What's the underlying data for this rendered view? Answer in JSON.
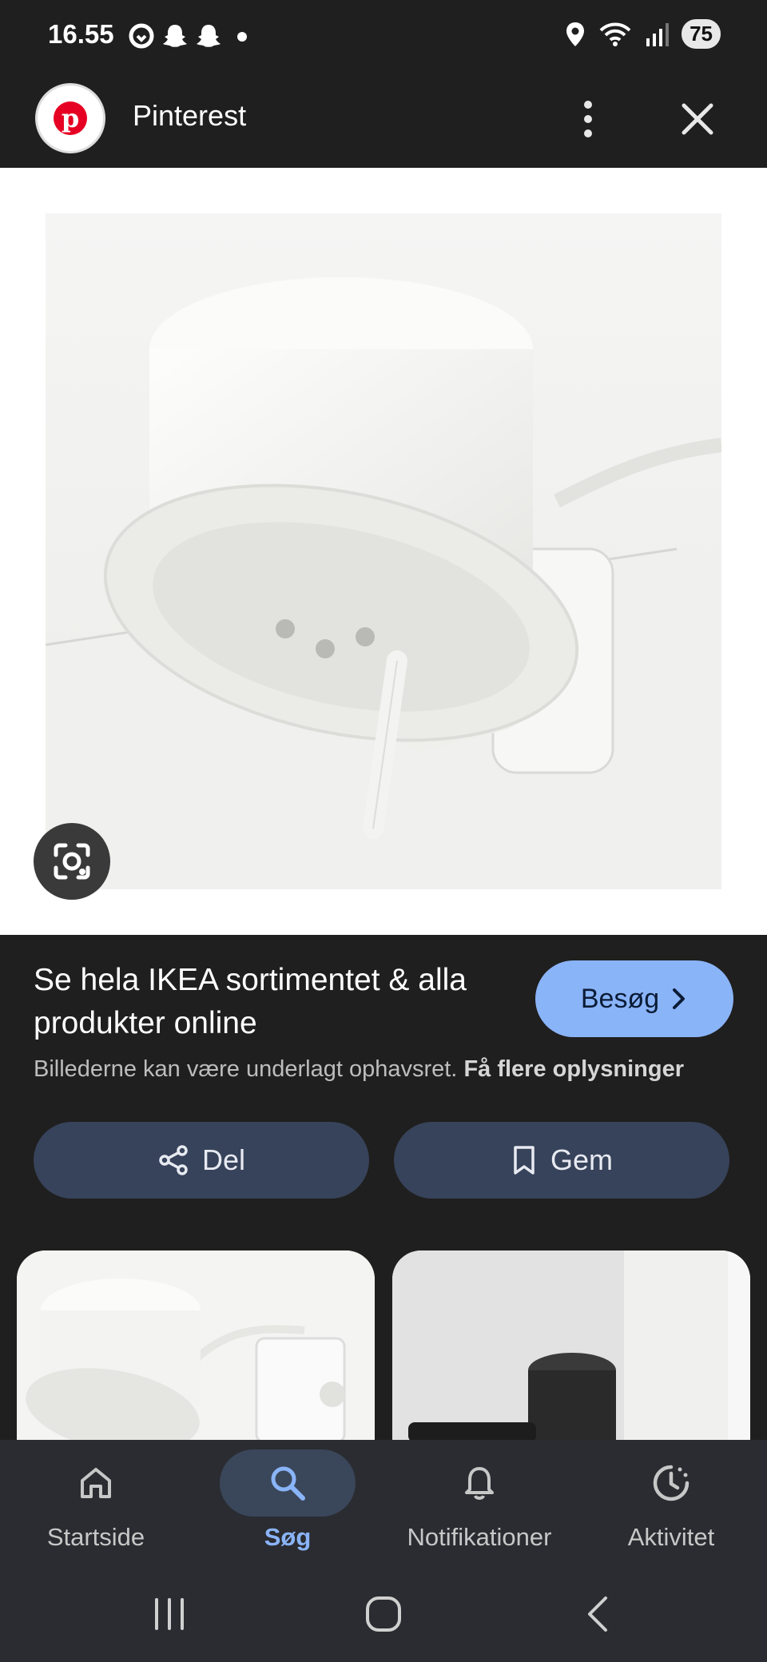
{
  "status_bar": {
    "time": "16.55",
    "battery": "75",
    "left_icons": [
      "sync-icon",
      "snapchat-icon",
      "snapchat-icon",
      "dot-icon"
    ],
    "right_icons": [
      "location-icon",
      "wifi-icon",
      "signal-icon"
    ]
  },
  "app_header": {
    "title": "Pinterest",
    "logo_letter": "p",
    "brand_color": "#e60023"
  },
  "result": {
    "title": "Se hela IKEA sortimentet & alla produkter online",
    "visit_label": "Besøg",
    "copyright_text": "Billederne kan være underlagt ophavsret.",
    "copyright_link": "Få flere oplysninger"
  },
  "actions": {
    "share_label": "Del",
    "save_label": "Gem"
  },
  "bottom_nav": {
    "items": [
      {
        "label": "Startside",
        "icon": "home-icon",
        "active": false
      },
      {
        "label": "Søg",
        "icon": "search-icon",
        "active": true
      },
      {
        "label": "Notifikationer",
        "icon": "bell-icon",
        "active": false
      },
      {
        "label": "Aktivitet",
        "icon": "activity-icon",
        "active": false
      }
    ]
  },
  "colors": {
    "background": "#1f1f1f",
    "accent": "#8ab4f8",
    "button_bg": "#37435a"
  }
}
